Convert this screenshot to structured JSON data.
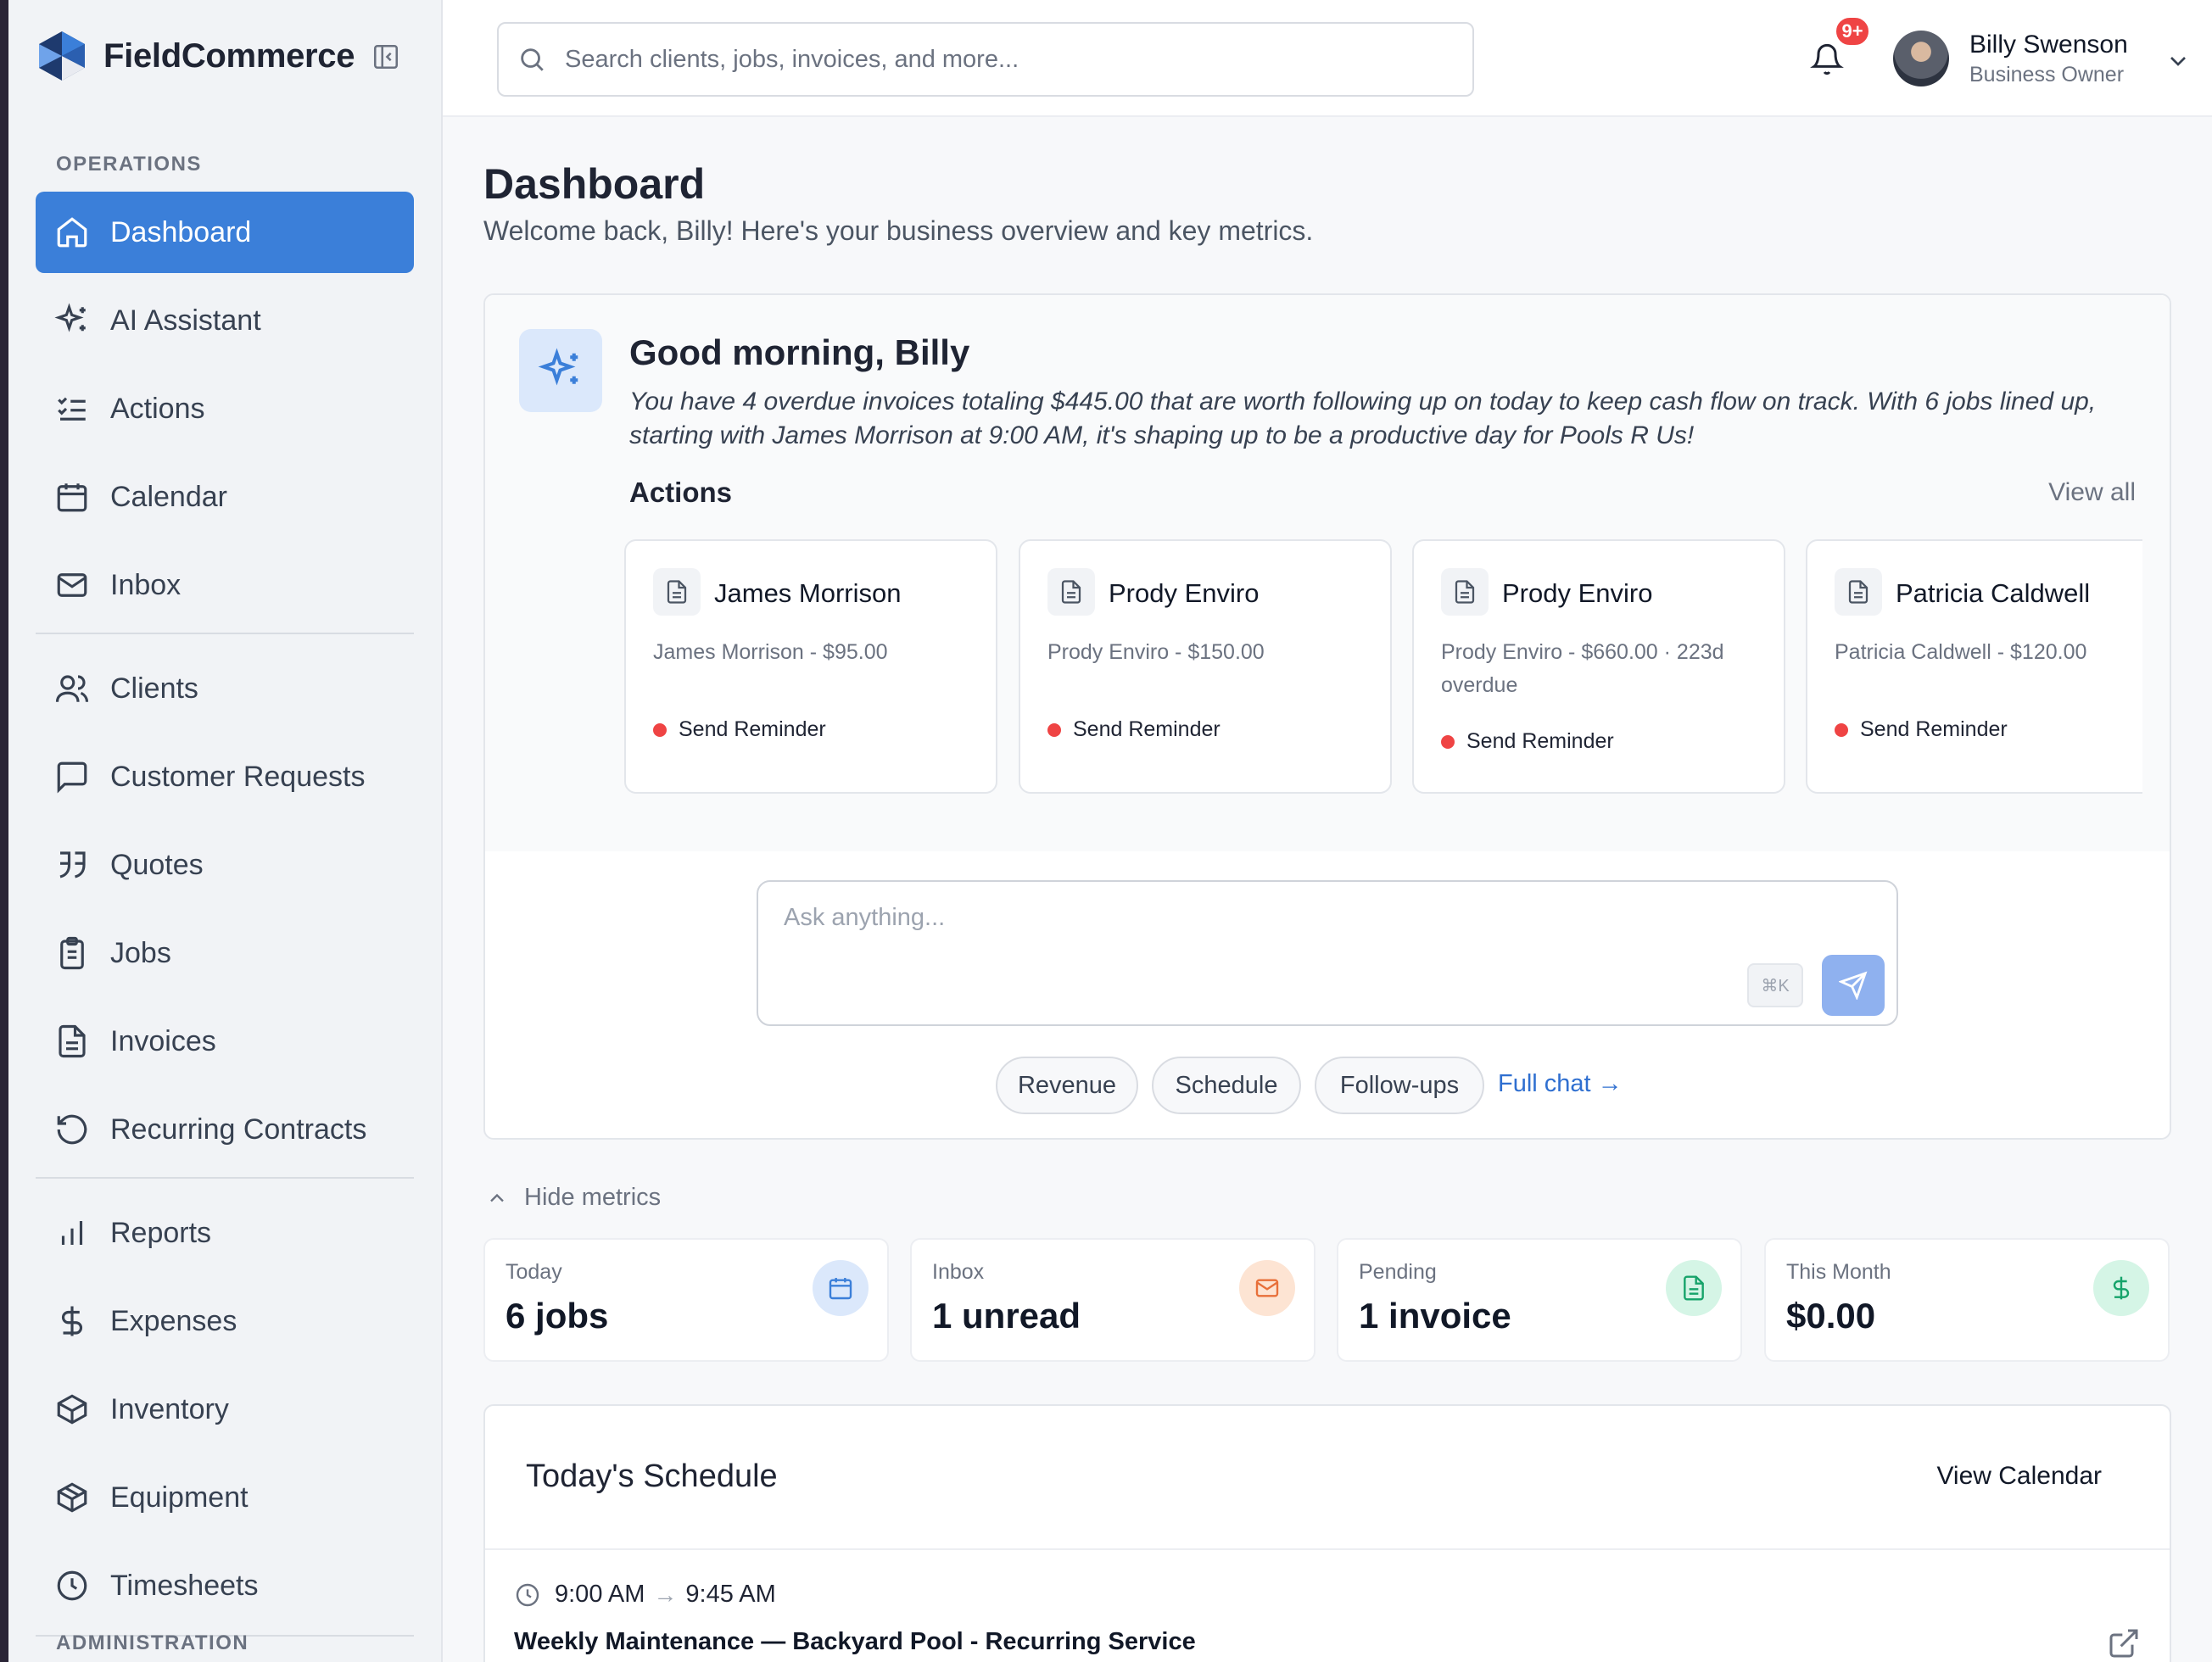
{
  "app": {
    "name": "FieldCommerce"
  },
  "sidebar": {
    "section_operations": "OPERATIONS",
    "section_administration": "ADMINISTRATION",
    "items": [
      {
        "label": "Dashboard",
        "icon": "home-icon"
      },
      {
        "label": "AI Assistant",
        "icon": "sparkle-icon"
      },
      {
        "label": "Actions",
        "icon": "checklist-icon"
      },
      {
        "label": "Calendar",
        "icon": "calendar-icon"
      },
      {
        "label": "Inbox",
        "icon": "mail-icon"
      },
      {
        "label": "Clients",
        "icon": "users-icon"
      },
      {
        "label": "Customer Requests",
        "icon": "message-square-icon"
      },
      {
        "label": "Quotes",
        "icon": "quote-icon"
      },
      {
        "label": "Jobs",
        "icon": "clipboard-icon"
      },
      {
        "label": "Invoices",
        "icon": "file-text-icon"
      },
      {
        "label": "Recurring Contracts",
        "icon": "rotate-icon"
      },
      {
        "label": "Reports",
        "icon": "bar-chart-icon"
      },
      {
        "label": "Expenses",
        "icon": "dollar-icon"
      },
      {
        "label": "Inventory",
        "icon": "box-icon"
      },
      {
        "label": "Equipment",
        "icon": "package-icon"
      },
      {
        "label": "Timesheets",
        "icon": "clock-icon"
      }
    ]
  },
  "topbar": {
    "search_placeholder": "Search clients, jobs, invoices, and more...",
    "notif_count": "9+",
    "user_name": "Billy Swenson",
    "user_role": "Business Owner"
  },
  "page": {
    "title": "Dashboard",
    "subtitle": "Welcome back, Billy! Here's your business overview and key metrics."
  },
  "greeting": {
    "title": "Good morning, Billy",
    "message": "You have 4 overdue invoices totaling $445.00 that are worth following up on today to keep cash flow on track. With 6 jobs lined up, starting with James Morrison at 9:00 AM, it's shaping up to be a productive day for Pools R Us!",
    "actions_label": "Actions",
    "view_all": "View all",
    "actions": [
      {
        "name": "James Morrison",
        "desc": "James Morrison - $95.00",
        "cta": "Send Reminder"
      },
      {
        "name": "Prody Enviro",
        "desc": "Prody Enviro - $150.00",
        "cta": "Send Reminder"
      },
      {
        "name": "Prody Enviro",
        "desc": "Prody Enviro - $660.00 · 223d overdue",
        "cta": "Send Reminder"
      },
      {
        "name": "Patricia Caldwell",
        "desc": "Patricia Caldwell - $120.00",
        "cta": "Send Reminder"
      }
    ],
    "ask_placeholder": "Ask anything...",
    "shortcut": "⌘K",
    "chips": [
      "Revenue",
      "Schedule",
      "Follow-ups"
    ],
    "full_chat": "Full chat →"
  },
  "metrics": {
    "toggle_label": "Hide metrics",
    "cards": [
      {
        "label": "Today",
        "value": "6 jobs",
        "icon": "calendar-icon",
        "color": "#3b7fd9",
        "bg": "#dbe8fb"
      },
      {
        "label": "Inbox",
        "value": "1 unread",
        "icon": "mail-icon",
        "color": "#e8703a",
        "bg": "#fde4d3"
      },
      {
        "label": "Pending",
        "value": "1 invoice",
        "icon": "file-text-icon",
        "color": "#16a36a",
        "bg": "#d5f5e6"
      },
      {
        "label": "This Month",
        "value": "$0.00",
        "icon": "dollar-icon",
        "color": "#16a36a",
        "bg": "#d5f5e6"
      }
    ]
  },
  "schedule": {
    "title": "Today's Schedule",
    "view_calendar": "View Calendar",
    "item": {
      "start": "9:00 AM",
      "arrow": "→",
      "end": "9:45 AM",
      "job": "Weekly Maintenance — Backyard Pool - Recurring Service"
    }
  },
  "colors": {
    "accent": "#3b7fd9",
    "danger": "#ef4444"
  }
}
